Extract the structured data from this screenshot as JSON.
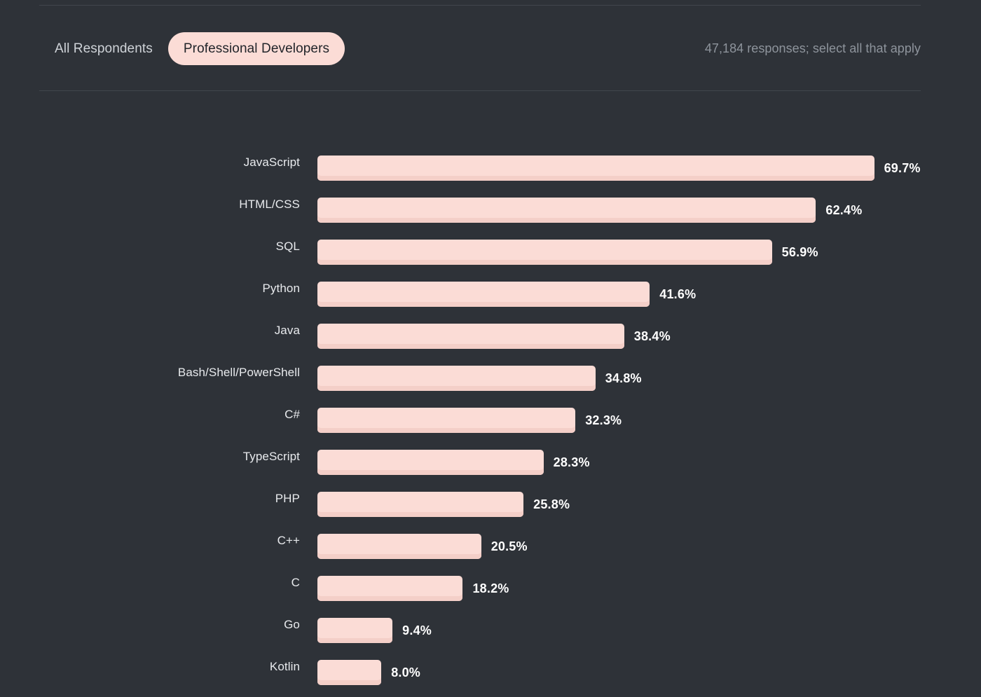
{
  "header": {
    "segments": [
      {
        "label": "All Respondents",
        "active": false
      },
      {
        "label": "Professional Developers",
        "active": true
      }
    ],
    "responses_note": "47,184 responses; select all that apply"
  },
  "colors": {
    "background": "#2e3238",
    "bar_fill": "#fbdcd6",
    "bar_shade": "#f4cfc8",
    "label_text": "#e8eaed",
    "value_text": "#ffffff",
    "muted_text": "#8e949c",
    "divider": "#41464d",
    "pill_text": "#22252a"
  },
  "chart_data": {
    "type": "bar",
    "orientation": "horizontal",
    "title": "",
    "subtitle": "",
    "xlabel": "",
    "ylabel": "",
    "xlim": [
      0,
      100
    ],
    "grid": false,
    "legend": null,
    "value_suffix": "%",
    "categories": [
      "JavaScript",
      "HTML/CSS",
      "SQL",
      "Python",
      "Java",
      "Bash/Shell/PowerShell",
      "C#",
      "TypeScript",
      "PHP",
      "C++",
      "C",
      "Go",
      "Kotlin"
    ],
    "values": [
      69.7,
      62.4,
      56.9,
      41.6,
      38.4,
      34.8,
      32.3,
      28.3,
      25.8,
      20.5,
      18.2,
      9.4,
      8.0
    ],
    "value_labels": [
      "69.7%",
      "62.4%",
      "56.9%",
      "41.6%",
      "38.4%",
      "34.8%",
      "32.3%",
      "28.3%",
      "25.8%",
      "20.5%",
      "18.2%",
      "9.4%",
      "8.0%"
    ]
  }
}
